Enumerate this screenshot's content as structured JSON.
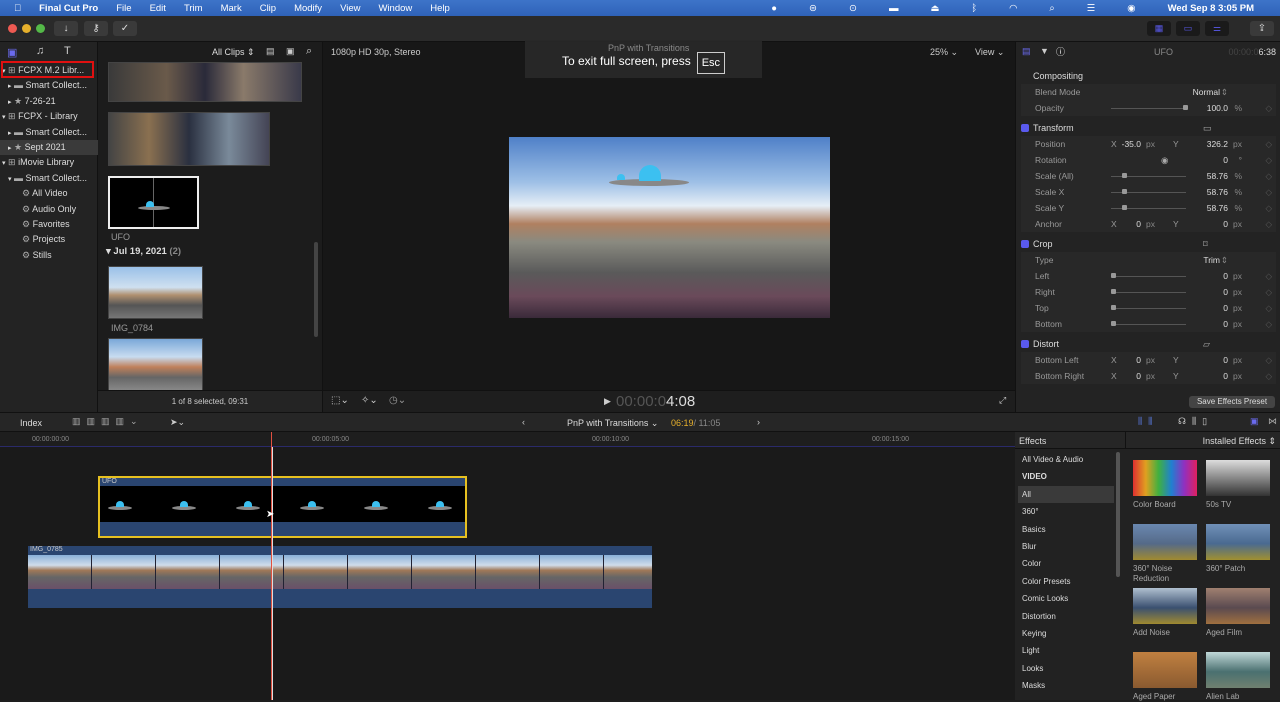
{
  "menubar": {
    "app": "Final Cut Pro",
    "items": [
      "File",
      "Edit",
      "Trim",
      "Mark",
      "Clip",
      "Modify",
      "View",
      "Window",
      "Help"
    ],
    "clock": "Wed Sep 8  3:05 PM"
  },
  "sidebar": {
    "items": [
      {
        "label": "FCPX M.2 Libr...",
        "type": "library"
      },
      {
        "label": "Smart Collect...",
        "type": "folder"
      },
      {
        "label": "7-26-21",
        "type": "event"
      },
      {
        "label": "FCPX - Library",
        "type": "library"
      },
      {
        "label": "Smart Collect...",
        "type": "folder"
      },
      {
        "label": "Sept 2021",
        "type": "event"
      },
      {
        "label": "iMovie Library",
        "type": "library"
      },
      {
        "label": "Smart Collect...",
        "type": "folder"
      },
      {
        "label": "All Video",
        "type": "smart"
      },
      {
        "label": "Audio Only",
        "type": "smart"
      },
      {
        "label": "Favorites",
        "type": "smart"
      },
      {
        "label": "Projects",
        "type": "smart"
      },
      {
        "label": "Stills",
        "type": "smart"
      }
    ]
  },
  "browser": {
    "filter": "All Clips",
    "ufo_label": "UFO",
    "date_group": "Jul 19, 2021",
    "date_count": "(2)",
    "clip1": "IMG_0784",
    "status": "1 of 8 selected, 09:31"
  },
  "viewer": {
    "format": "1080p HD 30p, Stereo",
    "project": "PnP with Transitions",
    "zoom": "25%",
    "view": "View",
    "timecode_dim": "00:00:0",
    "timecode": "4:08",
    "fullscreen_msg": "To exit full screen, press",
    "esc": "Esc"
  },
  "inspector": {
    "title": "UFO",
    "duration_dim": "00:00:0",
    "duration": "6:38",
    "compositing": "Compositing",
    "blend_label": "Blend Mode",
    "blend": "Normal",
    "opacity_label": "Opacity",
    "opacity": "100.0",
    "opacity_unit": "%",
    "opacity_fraction": 1.0,
    "transform": "Transform",
    "position": "Position",
    "pos_x": "-35.0",
    "pos_y": "326.2",
    "rotation": "Rotation",
    "rot": "0",
    "rot_unit": "°",
    "scale_all": "Scale (All)",
    "scale_x": "Scale X",
    "scale_y": "Scale Y",
    "scale": "58.76",
    "pct": "%",
    "scale_fraction": 0.15,
    "anchor": "Anchor",
    "anchor_x": "0",
    "anchor_y": "0",
    "px": "px",
    "x": "X",
    "y": "Y",
    "crop": "Crop",
    "type": "Type",
    "trim": "Trim",
    "left": "Left",
    "right": "Right",
    "top": "Top",
    "bottom": "Bottom",
    "zero": "0",
    "distort": "Distort",
    "bottom_left": "Bottom Left",
    "bottom_right": "Bottom Right",
    "save_preset": "Save Effects Preset"
  },
  "timeline": {
    "index": "Index",
    "project": "PnP with Transitions",
    "pos": "06:19",
    "total": "/ 11:05",
    "ticks": [
      "00:00:00:00",
      "00:00:05:00",
      "00:00:10:00",
      "00:00:15:00"
    ],
    "clip_ufo": "UFO",
    "clip_main": "IMG_0785"
  },
  "effects": {
    "title": "Effects",
    "source": "Installed Effects",
    "categories": [
      "All Video & Audio",
      "VIDEO",
      "All",
      "360°",
      "Basics",
      "Blur",
      "Color",
      "Color Presets",
      "Comic Looks",
      "Distortion",
      "Keying",
      "Light",
      "Looks",
      "Masks"
    ],
    "tiles": [
      "Color Board",
      "50s TV",
      "360° Noise Reduction",
      "360° Patch",
      "Add Noise",
      "Aged Film",
      "Aged Paper",
      "Alien Lab"
    ]
  }
}
